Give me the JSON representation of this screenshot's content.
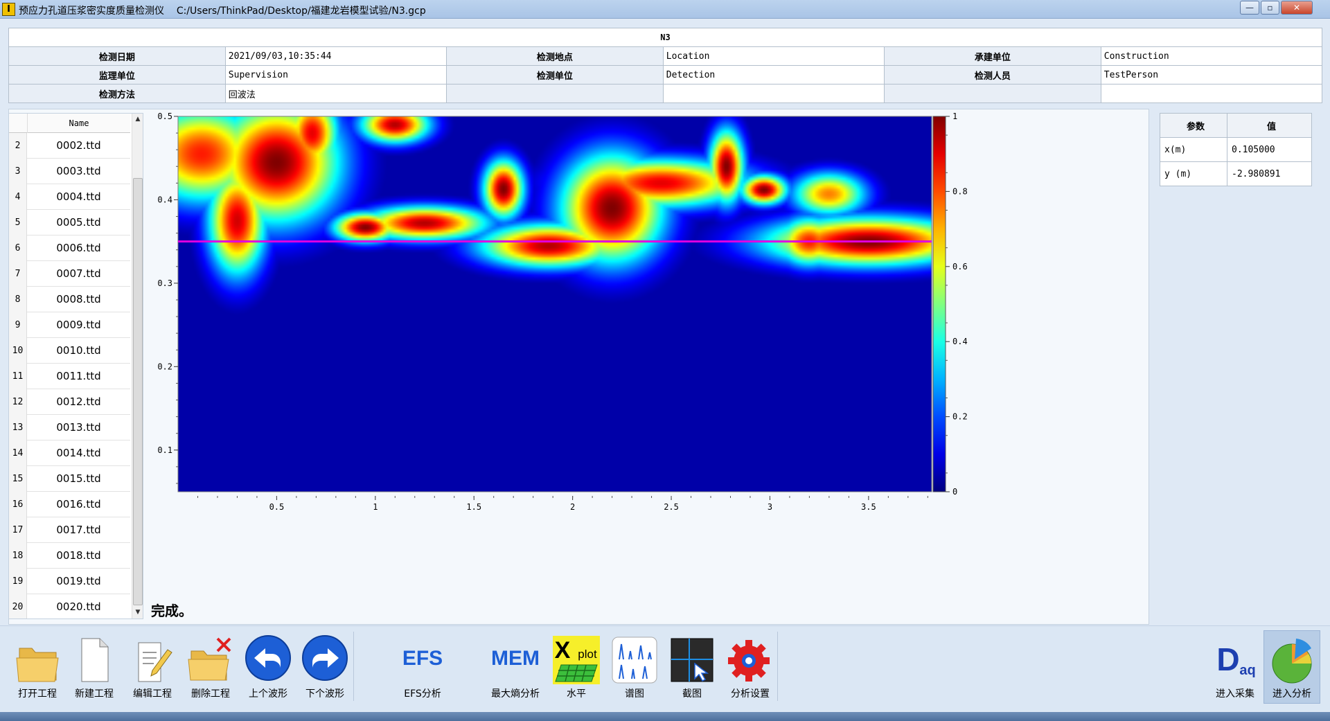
{
  "window": {
    "app_name": "预应力孔道压浆密实度质量检测仪",
    "file_path": "C:/Users/ThinkPad/Desktop/福建龙岩模型试验/N3.gcp",
    "icon_text": "I",
    "min_glyph": "—",
    "max_glyph": "▫",
    "close_glyph": "✕"
  },
  "info": {
    "title": "N3",
    "rows": [
      [
        "检测日期",
        "2021/09/03,10:35:44",
        "检测地点",
        "Location",
        "承建单位",
        "Construction"
      ],
      [
        "监理单位",
        "Supervision",
        "检测单位",
        "Detection",
        "检测人员",
        "TestPerson"
      ],
      [
        "检测方法",
        "回波法",
        "",
        "",
        "",
        ""
      ]
    ]
  },
  "file_list": {
    "header": "Name",
    "rows": [
      {
        "idx": "2",
        "name": "0002.ttd"
      },
      {
        "idx": "3",
        "name": "0003.ttd"
      },
      {
        "idx": "4",
        "name": "0004.ttd"
      },
      {
        "idx": "5",
        "name": "0005.ttd"
      },
      {
        "idx": "6",
        "name": "0006.ttd"
      },
      {
        "idx": "7",
        "name": "0007.ttd"
      },
      {
        "idx": "8",
        "name": "0008.ttd"
      },
      {
        "idx": "9",
        "name": "0009.ttd"
      },
      {
        "idx": "10",
        "name": "0010.ttd"
      },
      {
        "idx": "11",
        "name": "0011.ttd"
      },
      {
        "idx": "12",
        "name": "0012.ttd"
      },
      {
        "idx": "13",
        "name": "0013.ttd"
      },
      {
        "idx": "14",
        "name": "0014.ttd"
      },
      {
        "idx": "15",
        "name": "0015.ttd"
      },
      {
        "idx": "16",
        "name": "0016.ttd"
      },
      {
        "idx": "17",
        "name": "0017.ttd"
      },
      {
        "idx": "18",
        "name": "0018.ttd"
      },
      {
        "idx": "19",
        "name": "0019.ttd"
      },
      {
        "idx": "20",
        "name": "0020.ttd"
      }
    ],
    "scroll_up": "▲",
    "scroll_down": "▼"
  },
  "status_text": "完成。",
  "params": {
    "headers": [
      "参数",
      "值"
    ],
    "rows": [
      {
        "name": "x(m)",
        "value": "0.105000"
      },
      {
        "name": "y (m)",
        "value": "-2.980891"
      }
    ]
  },
  "toolbar": {
    "buttons": [
      {
        "id": "open",
        "label": "打开工程",
        "icon": "folder-icon"
      },
      {
        "id": "new",
        "label": "新建工程",
        "icon": "document-icon"
      },
      {
        "id": "edit",
        "label": "编辑工程",
        "icon": "edit-document-icon"
      },
      {
        "id": "delete",
        "label": "删除工程",
        "icon": "delete-folder-icon"
      },
      {
        "id": "prev",
        "label": "上个波形",
        "icon": "arrow-left-icon"
      },
      {
        "id": "next",
        "label": "下个波形",
        "icon": "arrow-right-icon"
      },
      {
        "id": "efs",
        "label": "EFS分析",
        "icon": "efs-icon",
        "icon_text": "EFS"
      },
      {
        "id": "mem",
        "label": "最大熵分析",
        "icon": "mem-icon",
        "icon_text": "MEM"
      },
      {
        "id": "level",
        "label": "水平",
        "icon": "xplot-icon",
        "icon_text": "X",
        "icon_text2": "plot"
      },
      {
        "id": "spectrum",
        "label": "谱图",
        "icon": "spectrum-icon"
      },
      {
        "id": "screenshot",
        "label": "截图",
        "icon": "screenshot-icon"
      },
      {
        "id": "settings",
        "label": "分析设置",
        "icon": "gear-icon"
      },
      {
        "id": "acquire",
        "label": "进入采集",
        "icon": "daq-icon",
        "icon_text": "D",
        "icon_text2": "aq"
      },
      {
        "id": "analyze",
        "label": "进入分析",
        "icon": "pie-chart-icon"
      }
    ]
  },
  "colors": {
    "accent": "#1d5fd6",
    "horizon_line": "#e000e0",
    "low": "#00008f",
    "high": "#7f0000"
  },
  "chart_data": {
    "type": "heatmap",
    "title": "",
    "xlabel": "",
    "ylabel": "",
    "xlim": [
      0,
      3.82
    ],
    "ylim": [
      0.05,
      0.5
    ],
    "x_ticks": [
      0.5,
      1,
      1.5,
      2,
      2.5,
      3,
      3.5
    ],
    "x_tick_labels": [
      "0.5",
      "1",
      "1.5",
      "2",
      "2.5",
      "3",
      "3.5"
    ],
    "y_ticks": [
      0.1,
      0.2,
      0.3,
      0.4,
      0.5
    ],
    "y_tick_labels": [
      "0.1",
      "0.2",
      "0.3",
      "0.4",
      "0.5"
    ],
    "colorbar": {
      "range": [
        0,
        1
      ],
      "ticks": [
        0,
        0.2,
        0.4,
        0.6,
        0.8,
        1
      ],
      "tick_labels": [
        "0",
        "0.2",
        "0.4",
        "0.6",
        "0.8",
        "1"
      ],
      "colormap": "jet"
    },
    "horizon_y": 0.35,
    "hotspots": [
      {
        "x": 0.12,
        "y": 0.455,
        "sx": 0.22,
        "sy": 0.04,
        "v": 0.85
      },
      {
        "x": 0.5,
        "y": 0.445,
        "sx": 0.22,
        "sy": 0.05,
        "v": 1.0
      },
      {
        "x": 0.3,
        "y": 0.375,
        "sx": 0.1,
        "sy": 0.045,
        "v": 0.92
      },
      {
        "x": 0.68,
        "y": 0.48,
        "sx": 0.09,
        "sy": 0.03,
        "v": 0.9
      },
      {
        "x": 1.1,
        "y": 0.49,
        "sx": 0.12,
        "sy": 0.015,
        "v": 0.95
      },
      {
        "x": 0.95,
        "y": 0.367,
        "sx": 0.11,
        "sy": 0.012,
        "v": 1.0
      },
      {
        "x": 1.25,
        "y": 0.372,
        "sx": 0.22,
        "sy": 0.014,
        "v": 0.95
      },
      {
        "x": 1.65,
        "y": 0.413,
        "sx": 0.07,
        "sy": 0.024,
        "v": 1.0
      },
      {
        "x": 1.88,
        "y": 0.345,
        "sx": 0.24,
        "sy": 0.018,
        "v": 0.95
      },
      {
        "x": 2.2,
        "y": 0.39,
        "sx": 0.18,
        "sy": 0.045,
        "v": 1.0
      },
      {
        "x": 2.45,
        "y": 0.42,
        "sx": 0.3,
        "sy": 0.02,
        "v": 0.9
      },
      {
        "x": 2.78,
        "y": 0.44,
        "sx": 0.06,
        "sy": 0.03,
        "v": 1.0
      },
      {
        "x": 2.97,
        "y": 0.412,
        "sx": 0.08,
        "sy": 0.012,
        "v": 1.0
      },
      {
        "x": 3.3,
        "y": 0.407,
        "sx": 0.13,
        "sy": 0.018,
        "v": 0.75
      },
      {
        "x": 3.5,
        "y": 0.35,
        "sx": 0.36,
        "sy": 0.02,
        "v": 1.0
      },
      {
        "x": 3.2,
        "y": 0.35,
        "sx": 0.11,
        "sy": 0.02,
        "v": 0.85
      }
    ]
  }
}
